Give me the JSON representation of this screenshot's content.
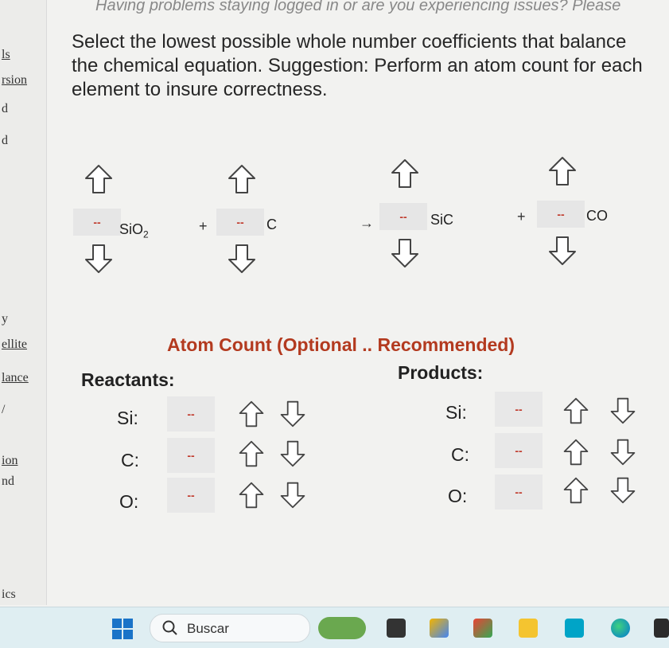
{
  "banner": {
    "text": "Having problems staying logged in or are you experiencing issues? Please"
  },
  "sidebar": {
    "items": [
      {
        "label": "ls"
      },
      {
        "label": "rsion"
      },
      {
        "label": "d"
      },
      {
        "label": "d"
      },
      {
        "label": "y"
      },
      {
        "label": "ellite"
      },
      {
        "label": "lance"
      },
      {
        "label": "/"
      },
      {
        "label": "ion"
      },
      {
        "label": "nd"
      },
      {
        "label": "ics"
      }
    ]
  },
  "instructions": "Select the lowest possible whole number coefficients that balance the chemical equation.   Suggestion: Perform an atom count for each element to insure correctness.",
  "equation": {
    "blank": "--",
    "reactant1": {
      "base": "SiO",
      "sub": "2"
    },
    "plus1": "+",
    "reactant2": "C",
    "arrow": "→",
    "product1": "SiC",
    "plus2": "+",
    "product2": "CO"
  },
  "atom_count": {
    "title": "Atom Count (Optional .. Recommended)",
    "reactants_label": "Reactants:",
    "products_label": "Products:",
    "reactants": [
      {
        "element": "Si:",
        "value": "--"
      },
      {
        "element": "C:",
        "value": "--"
      },
      {
        "element": "O:",
        "value": "--"
      }
    ],
    "products": [
      {
        "element": "Si:",
        "value": "--"
      },
      {
        "element": "C:",
        "value": "--"
      },
      {
        "element": "O:",
        "value": "--"
      }
    ]
  },
  "taskbar": {
    "search_placeholder": "Buscar"
  },
  "colors": {
    "blank": "#c0392b",
    "title": "#b33a1f"
  }
}
